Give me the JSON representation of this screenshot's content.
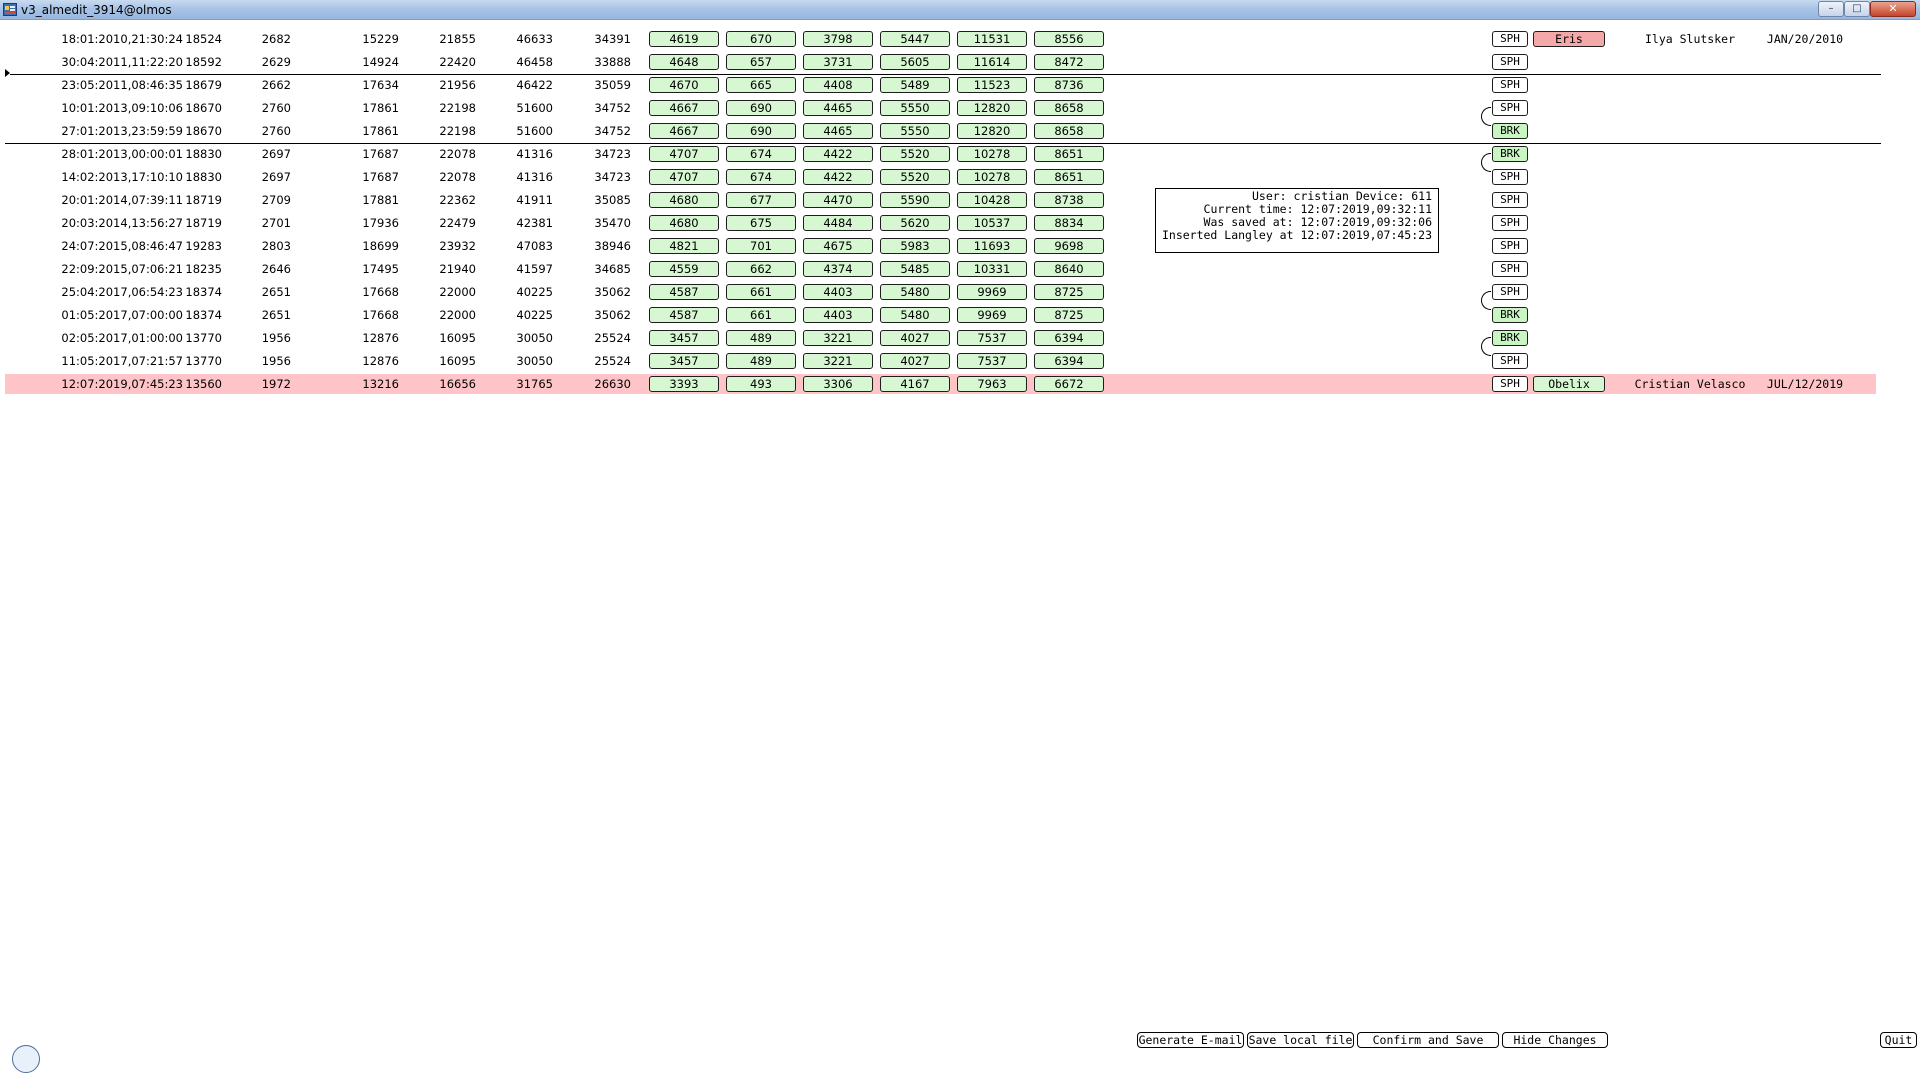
{
  "window": {
    "title": "v3_almedit_3914@olmos",
    "minimize_label": "–",
    "maximize_label": "□",
    "close_label": "✕"
  },
  "rows": [
    {
      "ts": "18:01:2010,21:30:24",
      "nums": [
        "18524",
        "2682",
        "15229",
        "21855",
        "46633",
        "34391"
      ],
      "boxes": [
        "4619",
        "670",
        "3798",
        "5447",
        "11531",
        "8556"
      ],
      "tag": "SPH",
      "name": "Eris",
      "name_style": "red",
      "person": "Ilya Slutsker",
      "date": "JAN/20/2010"
    },
    {
      "ts": "30:04:2011,11:22:20",
      "nums": [
        "18592",
        "2629",
        "14924",
        "22420",
        "46458",
        "33888"
      ],
      "boxes": [
        "4648",
        "657",
        "3731",
        "5605",
        "11614",
        "8472"
      ],
      "tag": "SPH"
    },
    {
      "ts": "23:05:2011,08:46:35",
      "nums": [
        "18679",
        "2662",
        "17634",
        "21956",
        "46422",
        "35059"
      ],
      "boxes": [
        "4670",
        "665",
        "4408",
        "5489",
        "11523",
        "8736"
      ],
      "tag": "SPH"
    },
    {
      "ts": "10:01:2013,09:10:06",
      "nums": [
        "18670",
        "2760",
        "17861",
        "22198",
        "51600",
        "34752"
      ],
      "boxes": [
        "4667",
        "690",
        "4465",
        "5550",
        "12820",
        "8658"
      ],
      "tag": "SPH"
    },
    {
      "ts": "27:01:2013,23:59:59",
      "nums": [
        "18670",
        "2760",
        "17861",
        "22198",
        "51600",
        "34752"
      ],
      "boxes": [
        "4667",
        "690",
        "4465",
        "5550",
        "12820",
        "8658"
      ],
      "tag": "BRK"
    },
    {
      "ts": "28:01:2013,00:00:01",
      "nums": [
        "18830",
        "2697",
        "17687",
        "22078",
        "41316",
        "34723"
      ],
      "boxes": [
        "4707",
        "674",
        "4422",
        "5520",
        "10278",
        "8651"
      ],
      "tag": "BRK"
    },
    {
      "ts": "14:02:2013,17:10:10",
      "nums": [
        "18830",
        "2697",
        "17687",
        "22078",
        "41316",
        "34723"
      ],
      "boxes": [
        "4707",
        "674",
        "4422",
        "5520",
        "10278",
        "8651"
      ],
      "tag": "SPH"
    },
    {
      "ts": "20:01:2014,07:39:11",
      "nums": [
        "18719",
        "2709",
        "17881",
        "22362",
        "41911",
        "35085"
      ],
      "boxes": [
        "4680",
        "677",
        "4470",
        "5590",
        "10428",
        "8738"
      ],
      "tag": "SPH"
    },
    {
      "ts": "20:03:2014,13:56:27",
      "nums": [
        "18719",
        "2701",
        "17936",
        "22479",
        "42381",
        "35470"
      ],
      "boxes": [
        "4680",
        "675",
        "4484",
        "5620",
        "10537",
        "8834"
      ],
      "tag": "SPH"
    },
    {
      "ts": "24:07:2015,08:46:47",
      "nums": [
        "19283",
        "2803",
        "18699",
        "23932",
        "47083",
        "38946"
      ],
      "boxes": [
        "4821",
        "701",
        "4675",
        "5983",
        "11693",
        "9698"
      ],
      "tag": "SPH"
    },
    {
      "ts": "22:09:2015,07:06:21",
      "nums": [
        "18235",
        "2646",
        "17495",
        "21940",
        "41597",
        "34685"
      ],
      "boxes": [
        "4559",
        "662",
        "4374",
        "5485",
        "10331",
        "8640"
      ],
      "tag": "SPH"
    },
    {
      "ts": "25:04:2017,06:54:23",
      "nums": [
        "18374",
        "2651",
        "17668",
        "22000",
        "40225",
        "35062"
      ],
      "boxes": [
        "4587",
        "661",
        "4403",
        "5480",
        "9969",
        "8725"
      ],
      "tag": "SPH"
    },
    {
      "ts": "01:05:2017,07:00:00",
      "nums": [
        "18374",
        "2651",
        "17668",
        "22000",
        "40225",
        "35062"
      ],
      "boxes": [
        "4587",
        "661",
        "4403",
        "5480",
        "9969",
        "8725"
      ],
      "tag": "BRK"
    },
    {
      "ts": "02:05:2017,01:00:00",
      "nums": [
        "13770",
        "1956",
        "12876",
        "16095",
        "30050",
        "25524"
      ],
      "boxes": [
        "3457",
        "489",
        "3221",
        "4027",
        "7537",
        "6394"
      ],
      "tag": "BRK"
    },
    {
      "ts": "11:05:2017,07:21:57",
      "nums": [
        "13770",
        "1956",
        "12876",
        "16095",
        "30050",
        "25524"
      ],
      "boxes": [
        "3457",
        "489",
        "3221",
        "4027",
        "7537",
        "6394"
      ],
      "tag": "SPH"
    },
    {
      "ts": "12:07:2019,07:45:23",
      "nums": [
        "13560",
        "1972",
        "13216",
        "16656",
        "31765",
        "26630"
      ],
      "boxes": [
        "3393",
        "493",
        "3306",
        "4167",
        "7963",
        "6672"
      ],
      "tag": "SPH",
      "name": "Obelix",
      "name_style": "green",
      "person": "Cristian Velasco",
      "date": "JUL/12/2019",
      "highlight": true
    }
  ],
  "info_panel": {
    "line1": "User: cristian Device: 611",
    "line2": "Current time: 12:07:2019,09:32:11",
    "line3": "Was saved at: 12:07:2019,09:32:06",
    "line4": "Inserted Langley at 12:07:2019,07:45:23"
  },
  "actions": {
    "generate_email": "Generate E-mail",
    "save_local": "Save local file",
    "confirm_save": "Confirm and Save",
    "hide_changes": "Hide Changes",
    "quit": "Quit"
  },
  "colors": {
    "value_box": "#d6f7d2",
    "brk_tag": "#c9f5c3",
    "red_name": "#f5a8a8",
    "highlight_row": "#ffc4c8"
  }
}
